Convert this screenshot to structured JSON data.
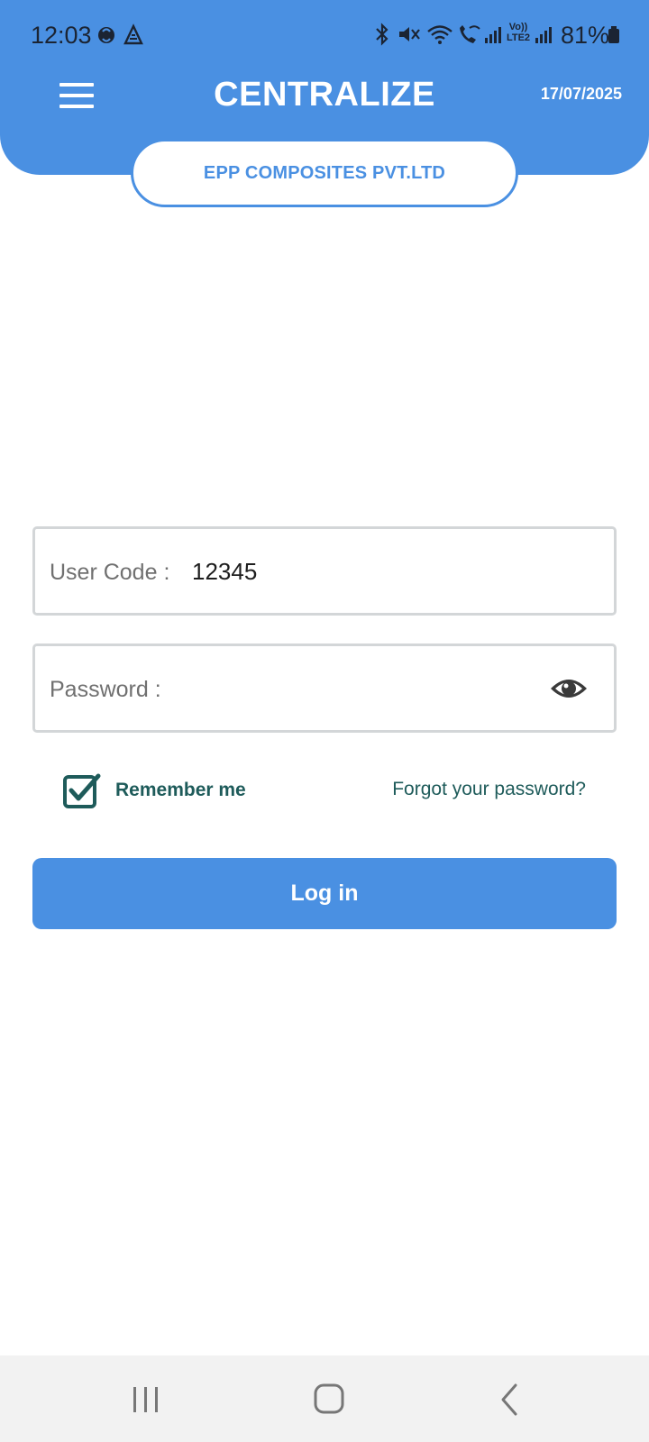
{
  "status_bar": {
    "time": "12:03",
    "battery": "81%",
    "left_icons": [
      "sync-icon",
      "a-logo-icon"
    ],
    "right_icons": [
      "bluetooth-icon",
      "mute-icon",
      "wifi-icon",
      "wifi-calling-icon",
      "signal-icon",
      "volte-icon",
      "signal-icon",
      "battery-icon"
    ],
    "volte_label": "Vo))",
    "lte_label": "LTE2"
  },
  "header": {
    "title": "CENTRALIZE",
    "date": "17/07/2025",
    "menu_icon": "hamburger-icon",
    "color": "#4a90e2"
  },
  "company": {
    "name": "EPP COMPOSITES PVT.LTD"
  },
  "login_form": {
    "user_code": {
      "label": "User Code :",
      "value": "12345"
    },
    "password": {
      "label": "Password :",
      "value": "",
      "toggle_icon": "eye-icon"
    },
    "remember_me": {
      "label": "Remember me",
      "checked": true
    },
    "forgot_password": "Forgot your password?",
    "submit_label": "Log in"
  },
  "nav_bar": {
    "buttons": [
      "recent-apps-icon",
      "home-icon",
      "back-icon"
    ]
  },
  "colors": {
    "accent": "#4a90e2",
    "teal": "#1e5b5a",
    "field_border": "#d3d6d8"
  }
}
